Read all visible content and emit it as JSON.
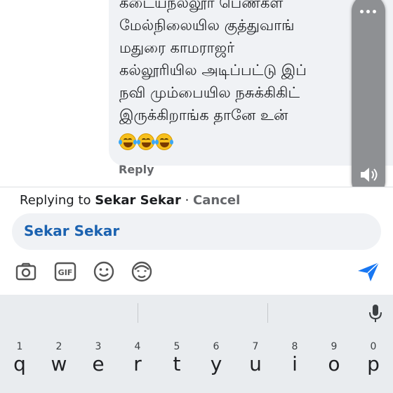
{
  "comment": {
    "lines": [
      "கடையநல்லூர் பெண்கள்",
      "மேல்நிலையில குத்துவாங்",
      "மதுரை காமராஜர்",
      "கல்லூரியில அடிப்பட்டு இப்",
      "நவி மும்பையில நசுக்கிகிட்",
      "இருக்கிறாங்க தானே உன்"
    ],
    "emojis": [
      "rolling-on-floor-laughing",
      "rolling-on-floor-laughing",
      "rolling-on-floor-laughing"
    ],
    "reply_label": "Reply"
  },
  "floating_panel": {
    "icons": [
      "more-dots-icon",
      "speaker-icon"
    ]
  },
  "replying": {
    "prefix": "Replying to",
    "name": "Sekar Sekar",
    "separator": "·",
    "cancel": "Cancel"
  },
  "input": {
    "mention": "Sekar Sekar"
  },
  "attachments": {
    "icons": [
      "camera-icon",
      "gif-icon",
      "emoji-icon",
      "avatar-sticker-icon"
    ],
    "send_icon": "send-icon",
    "gif_text": "GIF",
    "accent": "#1877f2"
  },
  "keyboard": {
    "suggestions": [
      "",
      "",
      ""
    ],
    "keys": [
      {
        "num": "1",
        "letter": "q"
      },
      {
        "num": "2",
        "letter": "w"
      },
      {
        "num": "3",
        "letter": "e"
      },
      {
        "num": "4",
        "letter": "r"
      },
      {
        "num": "5",
        "letter": "t"
      },
      {
        "num": "6",
        "letter": "y"
      },
      {
        "num": "7",
        "letter": "u"
      },
      {
        "num": "8",
        "letter": "i"
      },
      {
        "num": "9",
        "letter": "o"
      },
      {
        "num": "0",
        "letter": "p"
      }
    ]
  }
}
